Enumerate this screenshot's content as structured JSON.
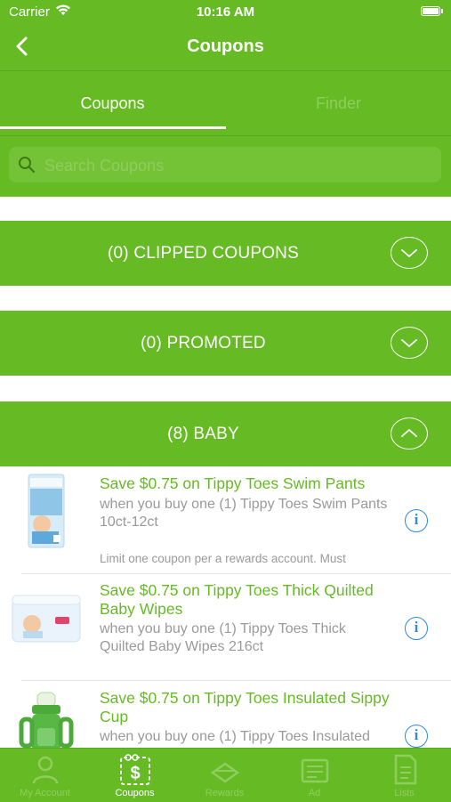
{
  "status_bar": {
    "carrier": "Carrier",
    "time": "10:16 AM"
  },
  "header": {
    "title": "Coupons"
  },
  "tabs": [
    {
      "label": "Coupons",
      "selected": true
    },
    {
      "label": "Finder",
      "selected": false
    }
  ],
  "search": {
    "placeholder": "Search Coupons",
    "value": ""
  },
  "categories": [
    {
      "label": "(0) CLIPPED COUPONS",
      "expanded": false
    },
    {
      "label": "(0) PROMOTED",
      "expanded": false
    },
    {
      "label": "(8) BABY",
      "expanded": true
    }
  ],
  "coupons": [
    {
      "title": "Save $0.75 on Tippy Toes Swim Pants",
      "description": "when you buy one (1) Tippy Toes Swim Pants 10ct-12ct",
      "limit": "Limit one coupon per a rewards account. Must"
    },
    {
      "title": "Save $0.75 on Tippy Toes Thick Quilted Baby Wipes",
      "description": "when you buy one (1) Tippy Toes Thick Quilted Baby Wipes 216ct",
      "limit": ""
    },
    {
      "title": "Save $0.75 on Tippy Toes Insulated Sippy Cup",
      "description": "when you buy one (1) Tippy Toes Insulated",
      "limit": ""
    }
  ],
  "bottom_tabs": [
    {
      "label": "My Account",
      "icon": "person-icon",
      "selected": false
    },
    {
      "label": "Coupons",
      "icon": "coupon-scissors-icon",
      "selected": true
    },
    {
      "label": "Rewards",
      "icon": "rewards-icon",
      "selected": false
    },
    {
      "label": "Ad",
      "icon": "weekly-ad-icon",
      "selected": false
    },
    {
      "label": "Lists",
      "icon": "list-icon",
      "selected": false
    }
  ],
  "colors": {
    "brand_green": "#66bb25",
    "info_blue": "#2f8ae0",
    "text_gray": "#9a9a9a"
  }
}
